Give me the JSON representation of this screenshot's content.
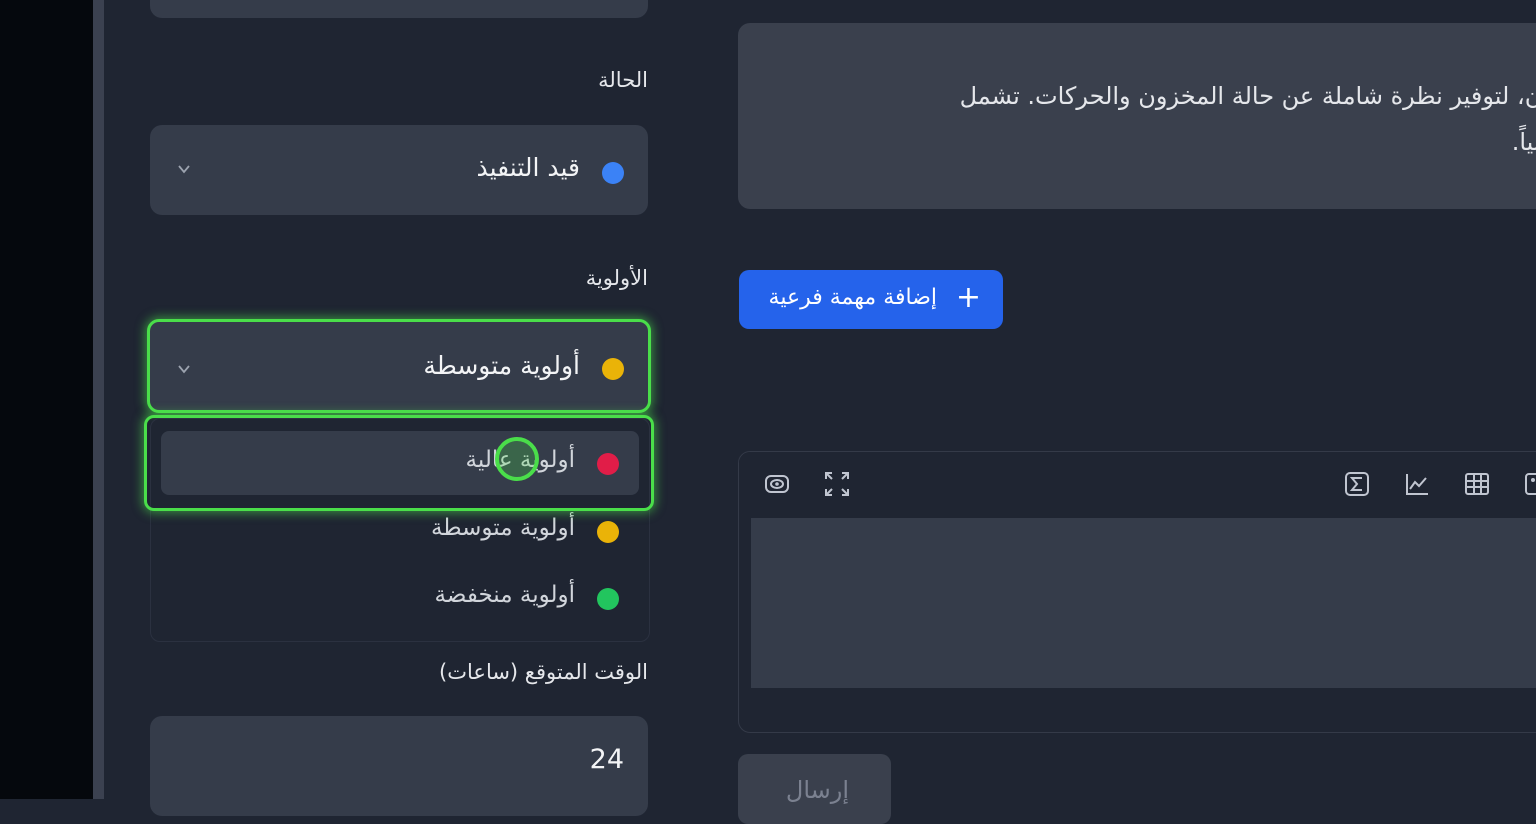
{
  "sidebar": {
    "status_label": "الحالة",
    "status_value": "قيد التنفيذ",
    "priority_label": "الأولوية",
    "priority_value": "أولوية متوسطة",
    "priority_options": [
      {
        "label": "أولوية عالية",
        "color": "#e11d48"
      },
      {
        "label": "أولوية متوسطة",
        "color": "#eab308"
      },
      {
        "label": "أولوية منخفضة",
        "color": "#22c55e"
      }
    ],
    "hours_label": "الوقت المتوقع (ساعات)",
    "hours_value": "24"
  },
  "colors": {
    "status_dot": "#3b82f6",
    "priority_dot": "#eab308",
    "focus_ring": "#4ade4a",
    "accent": "#2563eb"
  },
  "main": {
    "description_line1": "خزون، لتوفير نظرة شاملة عن حالة المخزون والحركات. تشمل",
    "description_line2": "ة بيانياً.",
    "add_subtask_label": "إضافة مهمة فرعية",
    "send_label": "إرسال"
  },
  "icons": [
    "eye-icon",
    "expand-icon",
    "sigma-icon",
    "chart-icon",
    "table-icon",
    "image-icon",
    "plus-icon",
    "chevron-down-icon"
  ]
}
